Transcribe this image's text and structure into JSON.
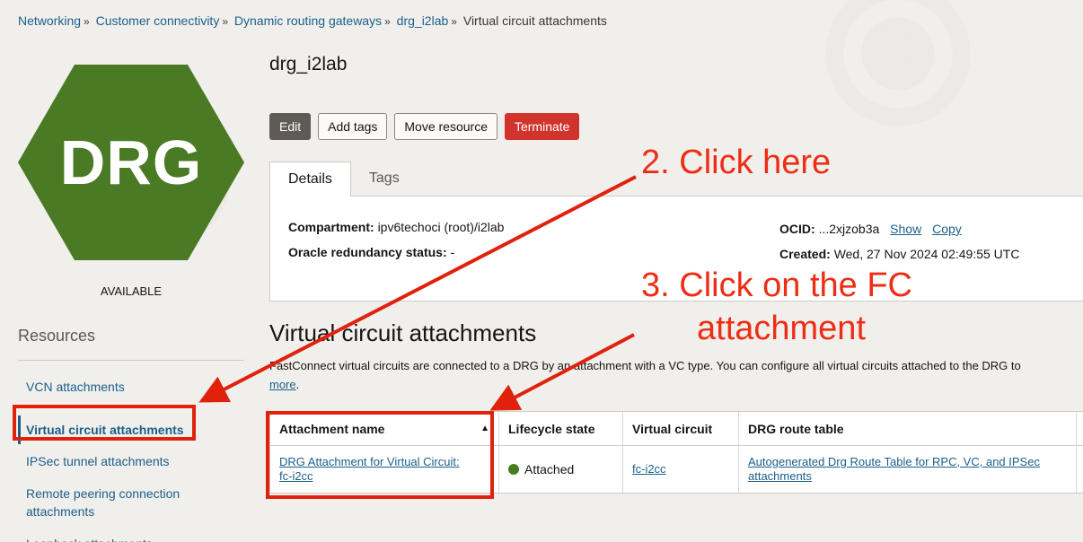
{
  "breadcrumb": {
    "items": [
      "Networking",
      "Customer connectivity",
      "Dynamic routing gateways",
      "drg_i2lab"
    ],
    "current": "Virtual circuit attachments",
    "separator": "»"
  },
  "resource_icon": {
    "label": "DRG",
    "color": "#4b7a24"
  },
  "status": "AVAILABLE",
  "resources": {
    "title": "Resources",
    "items": [
      {
        "label": "VCN attachments"
      },
      {
        "label": "Virtual circuit attachments"
      },
      {
        "label": "IPSec tunnel attachments"
      },
      {
        "label": "Remote peering connection attachments"
      },
      {
        "label": "Loopback attachments"
      }
    ]
  },
  "page_title": "drg_i2lab",
  "actions": {
    "edit": "Edit",
    "add_tags": "Add tags",
    "move": "Move resource",
    "terminate": "Terminate"
  },
  "tabs": {
    "details": "Details",
    "tags": "Tags"
  },
  "details": {
    "compartment_label": "Compartment:",
    "compartment_value": "ipv6techoci (root)/i2lab",
    "redundancy_label": "Oracle redundancy status:",
    "redundancy_value": "-",
    "ocid_label": "OCID:",
    "ocid_value": "...2xjzob3a",
    "show": "Show",
    "copy": "Copy",
    "created_label": "Created:",
    "created_value": "Wed, 27 Nov 2024 02:49:55 UTC"
  },
  "section": {
    "title": "Virtual circuit attachments",
    "description": "FastConnect virtual circuits are connected to a DRG by an attachment with a VC type. You can configure all virtual circuits attached to the DRG to",
    "more": "more"
  },
  "table": {
    "columns": [
      "Attachment name",
      "Lifecycle state",
      "Virtual circuit",
      "DRG route table"
    ],
    "rows": [
      {
        "name_line1": "DRG Attachment for Virtual Circuit:",
        "name_line2": "fc-i2cc",
        "state": "Attached",
        "circuit": "fc-i2cc",
        "route_line1": "Autogenerated Drg Route Table for RPC, VC, and IPSec",
        "route_line2": "attachments"
      }
    ]
  },
  "annotations": {
    "step2": "2. Click here",
    "step3_line1": "3. Click on the FC",
    "step3_line2": "attachment",
    "color": "#ee2d14"
  }
}
